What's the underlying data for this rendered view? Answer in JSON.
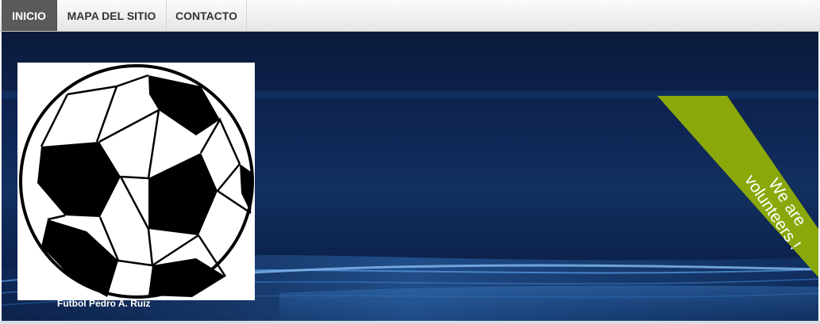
{
  "nav": {
    "tabs": [
      {
        "label": "INICIO",
        "active": true
      },
      {
        "label": "MAPA DEL SITIO",
        "active": false
      },
      {
        "label": "CONTACTO",
        "active": false
      }
    ]
  },
  "banner": {
    "caption": "Futbol Pedro A. Ruiz",
    "ribbon_line1": "We are",
    "ribbon_line2": "volunteers !",
    "ribbon_color": "#8aa80a"
  },
  "colors": {
    "nav_active_bg": "#5a5a5a",
    "banner_bg": "#0e2452",
    "wave_color": "#2f6fb8"
  }
}
